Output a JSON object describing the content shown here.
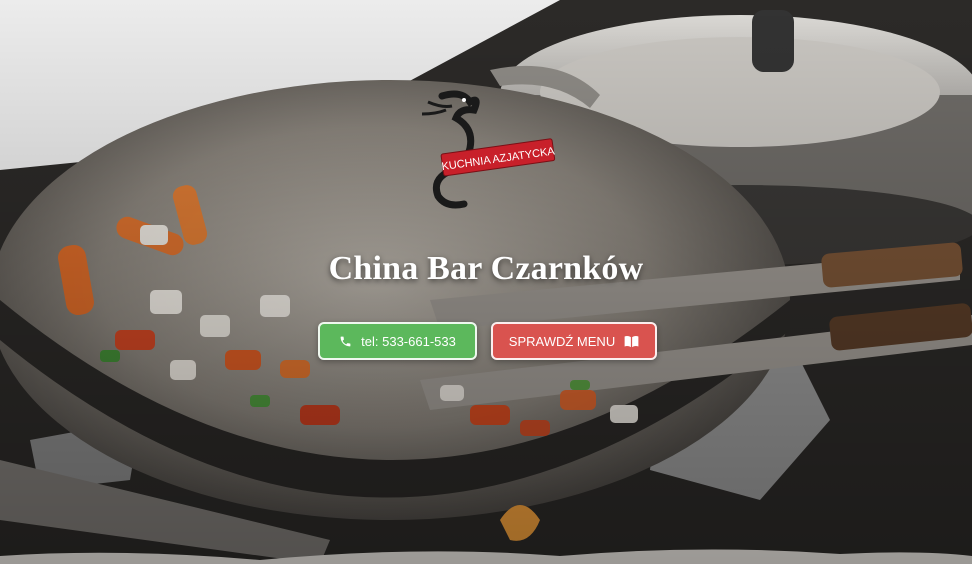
{
  "logo": {
    "text": "KUCHNIA AZJATYCKA",
    "icon": "dragon-icon",
    "banner_color": "#c8202a"
  },
  "hero": {
    "title": "China Bar Czarnków"
  },
  "buttons": {
    "call": {
      "label": "tel: 533-661-533",
      "icon": "phone-icon",
      "color": "#5cb85c"
    },
    "menu": {
      "label": "SPRAWDŹ MENU",
      "icon": "book-open-icon",
      "color": "#d9534f"
    }
  }
}
